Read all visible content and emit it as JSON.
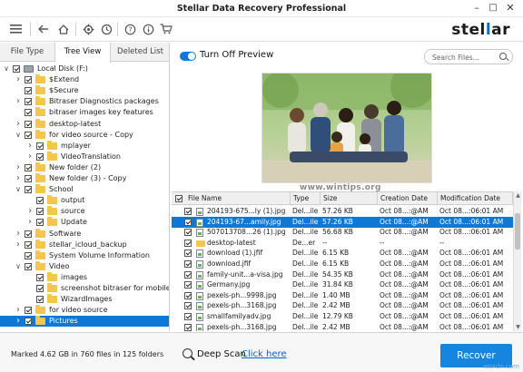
{
  "app": {
    "title": "Stellar Data Recovery Professional",
    "brand_prefix": "stel",
    "brand_accent": "l",
    "brand_suffix": "ar"
  },
  "tabs": [
    {
      "label": "File Type"
    },
    {
      "label": "Tree View",
      "active": true
    },
    {
      "label": "Deleted List"
    }
  ],
  "tree": [
    {
      "label": "Local Disk (F:)",
      "level": 0,
      "expand": "open",
      "icon": "drive"
    },
    {
      "label": "$Extend",
      "level": 1,
      "expand": "closed",
      "icon": "folder"
    },
    {
      "label": "$Secure",
      "level": 1,
      "expand": "none",
      "icon": "folder"
    },
    {
      "label": "Bitraser Diagnostics packages",
      "level": 1,
      "expand": "closed",
      "icon": "folder"
    },
    {
      "label": "bitraser images key features",
      "level": 1,
      "expand": "none",
      "icon": "folder"
    },
    {
      "label": "desktop-latest",
      "level": 1,
      "expand": "closed",
      "icon": "folder"
    },
    {
      "label": "for video source - Copy",
      "level": 1,
      "expand": "open",
      "icon": "folder"
    },
    {
      "label": "mplayer",
      "level": 2,
      "expand": "closed",
      "icon": "folder"
    },
    {
      "label": "VideoTranslation",
      "level": 2,
      "expand": "closed",
      "icon": "folder"
    },
    {
      "label": "New folder (2)",
      "level": 1,
      "expand": "closed",
      "icon": "folder"
    },
    {
      "label": "New folder (3) - Copy",
      "level": 1,
      "expand": "closed",
      "icon": "folder"
    },
    {
      "label": "School",
      "level": 1,
      "expand": "open",
      "icon": "folder"
    },
    {
      "label": "output",
      "level": 2,
      "expand": "none",
      "icon": "folder"
    },
    {
      "label": "source",
      "level": 2,
      "expand": "closed",
      "icon": "folder"
    },
    {
      "label": "Update",
      "level": 2,
      "expand": "closed",
      "icon": "folder"
    },
    {
      "label": "Software",
      "level": 1,
      "expand": "closed",
      "icon": "folder"
    },
    {
      "label": "stellar_icloud_backup",
      "level": 1,
      "expand": "closed",
      "icon": "folder"
    },
    {
      "label": "System Volume Information",
      "level": 1,
      "expand": "none",
      "icon": "folder"
    },
    {
      "label": "Video",
      "level": 1,
      "expand": "open",
      "icon": "folder"
    },
    {
      "label": "images",
      "level": 2,
      "expand": "none",
      "icon": "folder"
    },
    {
      "label": "screenshot bitraser for mobile",
      "level": 2,
      "expand": "none",
      "icon": "folder"
    },
    {
      "label": "WizardImages",
      "level": 2,
      "expand": "none",
      "icon": "folder"
    },
    {
      "label": "for video source",
      "level": 1,
      "expand": "closed",
      "icon": "folder"
    },
    {
      "label": "Pictures",
      "level": 1,
      "expand": "closed",
      "icon": "folder",
      "selected": true
    }
  ],
  "preview": {
    "toggle_label": "Turn Off Preview",
    "search_placeholder": "Search Files..."
  },
  "watermark_center": "www.wintips.org",
  "table": {
    "columns": [
      "File Name",
      "Type",
      "Size",
      "Creation Date",
      "Modification Date"
    ],
    "rows": [
      {
        "icon": "file",
        "name": "204193-675...ly (1).jpg",
        "type": "Del...ile",
        "size": "57.26 KB",
        "created": "Oct 08...:@AM",
        "modified": "Oct 08...:06:01 AM"
      },
      {
        "icon": "file",
        "name": "204193-67...amily.jpg",
        "type": "Del...ile",
        "size": "57.26 KB",
        "created": "Oct 08...:@AM",
        "modified": "Oct 08...:06:01 AM",
        "selected": true
      },
      {
        "icon": "file",
        "name": "507013708...26 (1).jpg",
        "type": "Del...ile",
        "size": "56.68 KB",
        "created": "Oct 08...:@AM",
        "modified": "Oct 08...:06:01 AM"
      },
      {
        "icon": "folder",
        "name": "desktop-latest",
        "type": "De...er",
        "size": "--",
        "created": "--",
        "modified": "--"
      },
      {
        "icon": "file",
        "name": "download (1).jfif",
        "type": "Del...ile",
        "size": "6.15 KB",
        "created": "Oct 08...:@AM",
        "modified": "Oct 08...:06:01 AM"
      },
      {
        "icon": "file",
        "name": "download.jfif",
        "type": "Del...ile",
        "size": "6.15 KB",
        "created": "Oct 08...:@AM",
        "modified": "Oct 08...:06:01 AM"
      },
      {
        "icon": "file",
        "name": "family-unit...a-visa.jpg",
        "type": "Del...ile",
        "size": "54.35 KB",
        "created": "Oct 08...:@AM",
        "modified": "Oct 08...:06:01 AM"
      },
      {
        "icon": "file",
        "name": "Germany.jpg",
        "type": "Del...ile",
        "size": "31.84 KB",
        "created": "Oct 08...:@AM",
        "modified": "Oct 08...:06:01 AM"
      },
      {
        "icon": "file",
        "name": "pexels-ph...9998.jpg",
        "type": "Del...ile",
        "size": "1.40 MB",
        "created": "Oct 08...:@AM",
        "modified": "Oct 08...:06:01 AM"
      },
      {
        "icon": "file",
        "name": "pexels-ph...3168.jpg",
        "type": "Del...ile",
        "size": "2.42 MB",
        "created": "Oct 08...:@AM",
        "modified": "Oct 08...:06:01 AM"
      },
      {
        "icon": "file",
        "name": "smallfamilyadv.jpg",
        "type": "Del...ile",
        "size": "12.79 KB",
        "created": "Oct 08...:@AM",
        "modified": "Oct 08...:06:01 AM"
      },
      {
        "icon": "file",
        "name": "pexels-ph...3168.jpg",
        "type": "Del...ile",
        "size": "2.42 MB",
        "created": "Oct 08...:@AM",
        "modified": "Oct 08...:06:01 AM"
      }
    ]
  },
  "status": {
    "marked": "Marked 4.62 GB in 760 files in 125 folders",
    "deep_scan_label": "Deep Scan",
    "deep_scan_link": "Click here",
    "recover_label": "Recover"
  },
  "watermark_corner": "wsxdn.com",
  "colors": {
    "accent": "#0d78d6",
    "recover": "#1585e0",
    "folder": "#f3c74a"
  }
}
